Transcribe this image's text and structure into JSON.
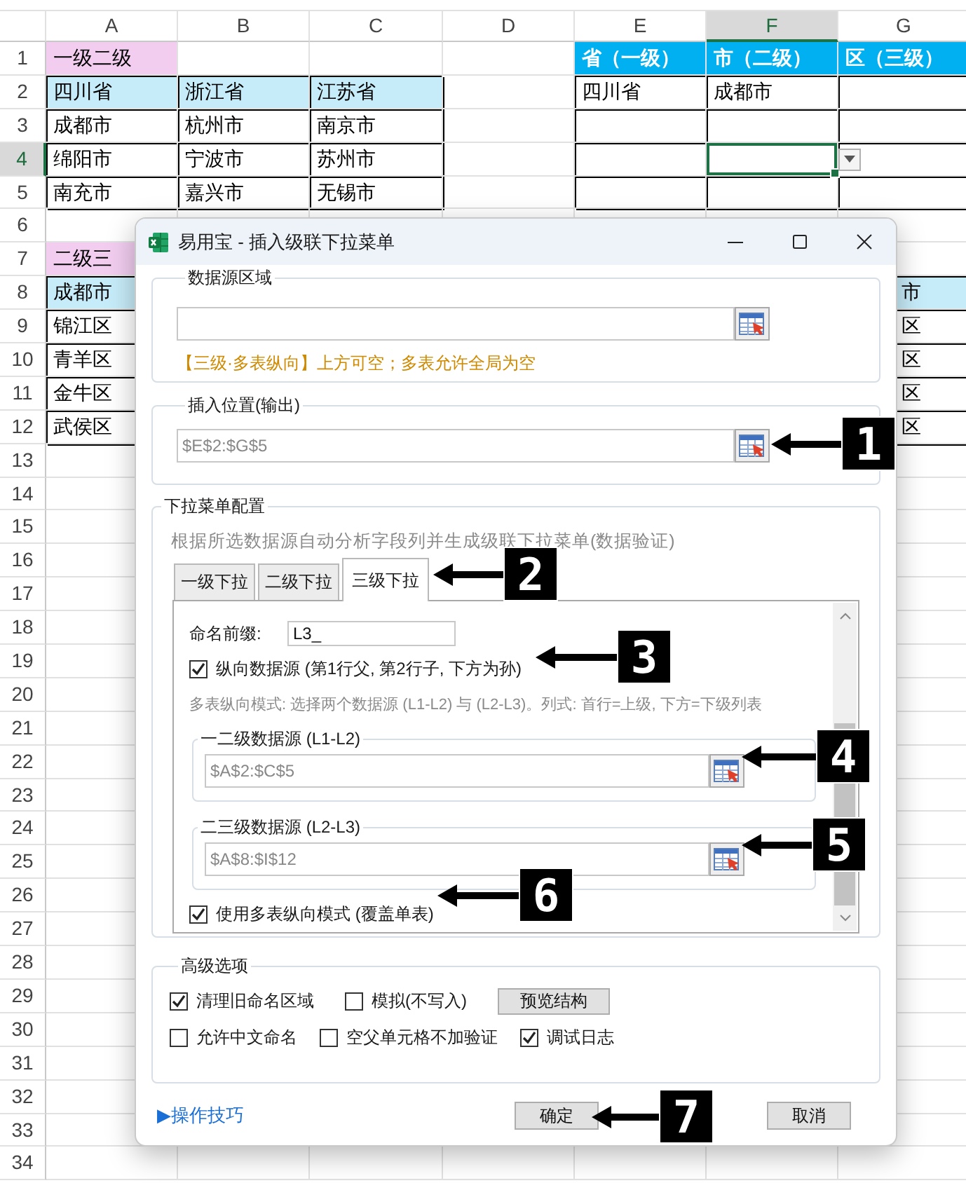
{
  "sheet": {
    "columns": [
      {
        "label": "A",
        "selected": false
      },
      {
        "label": "B",
        "selected": false
      },
      {
        "label": "C",
        "selected": false
      },
      {
        "label": "D",
        "selected": false
      },
      {
        "label": "E",
        "selected": false
      },
      {
        "label": "F",
        "selected": true
      },
      {
        "label": "G",
        "selected": false
      }
    ],
    "rows": [
      {
        "number": "1",
        "selected": false,
        "cells": [
          {
            "text": "一级二级",
            "kind": "pink"
          },
          {
            "kind": "plain"
          },
          {
            "kind": "plain"
          },
          {
            "kind": "plain"
          },
          {
            "text": "省（一级）",
            "kind": "head"
          },
          {
            "text": "市（二级）",
            "kind": "head"
          },
          {
            "text": "区（三级）",
            "kind": "head"
          }
        ]
      },
      {
        "number": "2",
        "selected": false,
        "cells": [
          {
            "text": "四川省",
            "kind": "blue"
          },
          {
            "text": "浙江省",
            "kind": "blue"
          },
          {
            "text": "江苏省",
            "kind": "blue"
          },
          {
            "kind": "plain"
          },
          {
            "text": "四川省",
            "kind": "box"
          },
          {
            "text": "成都市",
            "kind": "box"
          },
          {
            "kind": "box"
          }
        ]
      },
      {
        "number": "3",
        "selected": false,
        "cells": [
          {
            "text": "成都市",
            "kind": "box"
          },
          {
            "text": "杭州市",
            "kind": "box"
          },
          {
            "text": "南京市",
            "kind": "box"
          },
          {
            "kind": "plain"
          },
          {
            "kind": "box"
          },
          {
            "kind": "box"
          },
          {
            "kind": "box"
          }
        ]
      },
      {
        "number": "4",
        "selected": true,
        "cells": [
          {
            "text": "绵阳市",
            "kind": "box"
          },
          {
            "text": "宁波市",
            "kind": "box"
          },
          {
            "text": "苏州市",
            "kind": "box"
          },
          {
            "kind": "plain"
          },
          {
            "kind": "box"
          },
          {
            "kind": "box",
            "selected": true,
            "dropdown": true
          },
          {
            "kind": "box"
          }
        ]
      },
      {
        "number": "5",
        "selected": false,
        "cells": [
          {
            "text": "南充市",
            "kind": "box"
          },
          {
            "text": "嘉兴市",
            "kind": "box"
          },
          {
            "text": "无锡市",
            "kind": "box"
          },
          {
            "kind": "plain"
          },
          {
            "kind": "box"
          },
          {
            "kind": "box"
          },
          {
            "kind": "box"
          }
        ]
      },
      {
        "number": "6",
        "selected": false
      },
      {
        "number": "7",
        "selected": false,
        "cells": [
          {
            "text": "二级三",
            "kind": "pink"
          },
          {
            "kind": "plain"
          },
          {
            "kind": "plain"
          },
          {
            "kind": "plain"
          },
          {
            "kind": "plain"
          },
          {
            "kind": "plain"
          },
          {
            "kind": "plain"
          }
        ]
      },
      {
        "number": "8",
        "selected": false,
        "cells": [
          {
            "text": "成都市",
            "kind": "blue"
          },
          {
            "kind": "plain"
          },
          {
            "kind": "plain"
          },
          {
            "kind": "plain"
          },
          {
            "kind": "plain"
          },
          {
            "kind": "plain"
          },
          {
            "text": "市",
            "kind": "blue"
          }
        ]
      },
      {
        "number": "9",
        "selected": false,
        "cells": [
          {
            "text": "锦江区",
            "kind": "box"
          },
          {
            "kind": "plain"
          },
          {
            "kind": "plain"
          },
          {
            "kind": "plain"
          },
          {
            "kind": "plain"
          },
          {
            "kind": "plain"
          },
          {
            "text": "区",
            "kind": "box"
          }
        ]
      },
      {
        "number": "10",
        "selected": false,
        "cells": [
          {
            "text": "青羊区",
            "kind": "box"
          },
          {
            "kind": "plain"
          },
          {
            "kind": "plain"
          },
          {
            "kind": "plain"
          },
          {
            "kind": "plain"
          },
          {
            "kind": "plain"
          },
          {
            "text": "区",
            "kind": "box"
          }
        ]
      },
      {
        "number": "11",
        "selected": false,
        "cells": [
          {
            "text": "金牛区",
            "kind": "box"
          },
          {
            "kind": "plain"
          },
          {
            "kind": "plain"
          },
          {
            "kind": "plain"
          },
          {
            "kind": "plain"
          },
          {
            "kind": "plain"
          },
          {
            "text": "区",
            "kind": "box"
          }
        ]
      },
      {
        "number": "12",
        "selected": false,
        "cells": [
          {
            "text": "武侯区",
            "kind": "box"
          },
          {
            "kind": "plain"
          },
          {
            "kind": "plain"
          },
          {
            "kind": "plain"
          },
          {
            "kind": "plain"
          },
          {
            "kind": "plain"
          },
          {
            "text": "区",
            "kind": "box"
          }
        ]
      },
      {
        "number": "13",
        "selected": false
      },
      {
        "number": "14",
        "selected": false
      },
      {
        "number": "15",
        "selected": false
      },
      {
        "number": "16",
        "selected": false
      },
      {
        "number": "17",
        "selected": false
      },
      {
        "number": "18",
        "selected": false
      },
      {
        "number": "19",
        "selected": false
      },
      {
        "number": "20",
        "selected": false
      },
      {
        "number": "21",
        "selected": false
      },
      {
        "number": "22",
        "selected": false
      },
      {
        "number": "23",
        "selected": false
      },
      {
        "number": "24",
        "selected": false
      },
      {
        "number": "25",
        "selected": false
      },
      {
        "number": "26",
        "selected": false
      },
      {
        "number": "27",
        "selected": false
      },
      {
        "number": "28",
        "selected": false
      },
      {
        "number": "29",
        "selected": false
      },
      {
        "number": "30",
        "selected": false
      },
      {
        "number": "31",
        "selected": false
      },
      {
        "number": "32",
        "selected": false
      },
      {
        "number": "33",
        "selected": false
      },
      {
        "number": "34",
        "selected": false
      }
    ]
  },
  "dialog": {
    "title": "易用宝 - 插入级联下拉菜单",
    "source": {
      "legend": "数据源区域",
      "hint": "【三级·多表纵向】上方可空；多表允许全局为空"
    },
    "output": {
      "legend": "插入位置(输出)",
      "value": "$E$2:$G$5"
    },
    "config": {
      "legend": "下拉菜单配置",
      "description": "根据所选数据源自动分析字段列并生成级联下拉菜单(数据验证)",
      "tabs": [
        {
          "label": "一级下拉",
          "selected": false
        },
        {
          "label": "二级下拉",
          "selected": false
        },
        {
          "label": "三级下拉",
          "selected": true
        }
      ],
      "prefix_label": "命名前缀:",
      "prefix_value": "L3_",
      "vertical": {
        "label": "纵向数据源 (第1行父, 第2行子, 下方为孙)",
        "checked": true
      },
      "note": "多表纵向模式: 选择两个数据源 (L1-L2) 与 (L2-L3)。列式: 首行=上级, 下方=下级列表",
      "sources": [
        {
          "legend": "一二级数据源 (L1-L2)",
          "value": "$A$2:$C$5"
        },
        {
          "legend": "二三级数据源 (L2-L3)",
          "value": "$A$8:$I$12"
        }
      ],
      "multi": {
        "label": "使用多表纵向模式 (覆盖单表)",
        "checked": true
      }
    },
    "advanced": {
      "legend": "高级选项",
      "options": [
        {
          "label": "清理旧命名区域",
          "checked": true
        },
        {
          "label": "模拟(不写入)",
          "checked": false
        },
        {
          "label": "允许中文命名",
          "checked": false
        },
        {
          "label": "空父单元格不加验证",
          "checked": false
        },
        {
          "label": "调试日志",
          "checked": true
        }
      ],
      "preview_button": "预览结构"
    },
    "tips_link": "▶操作技巧",
    "buttons": [
      "确定",
      "取消"
    ]
  },
  "callouts": [
    "1",
    "2",
    "3",
    "4",
    "5",
    "6",
    "7"
  ]
}
